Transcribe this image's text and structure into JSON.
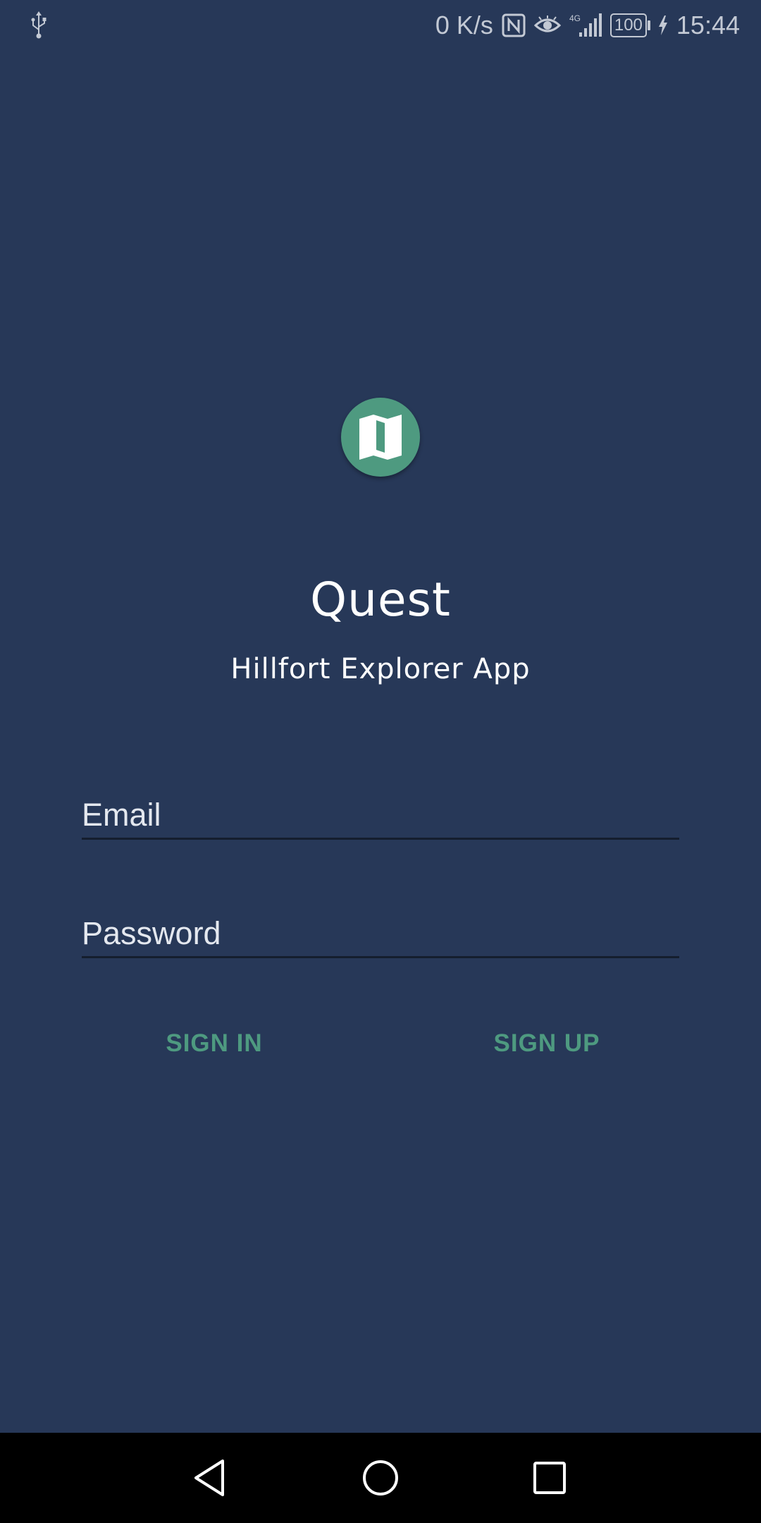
{
  "status_bar": {
    "network_speed": "0 K/s",
    "battery_level": "100",
    "time": "15:44",
    "signal_type": "4G",
    "icons": [
      "usb-icon",
      "nfc-icon",
      "eye-icon",
      "signal-icon",
      "battery-icon",
      "charging-icon"
    ]
  },
  "app": {
    "logo_icon": "map-icon",
    "title": "Quest",
    "subtitle": "Hillfort Explorer App"
  },
  "form": {
    "email": {
      "value": "",
      "placeholder": "Email"
    },
    "password": {
      "value": "",
      "placeholder": "Password"
    }
  },
  "actions": {
    "sign_in_label": "SIGN IN",
    "sign_up_label": "SIGN UP"
  },
  "nav_bar": {
    "icons": [
      "back-icon",
      "home-icon",
      "recent-apps-icon"
    ]
  },
  "colors": {
    "background": "#273858",
    "accent": "#4e9a80",
    "nav_bar": "#000000",
    "text": "#ffffff"
  }
}
